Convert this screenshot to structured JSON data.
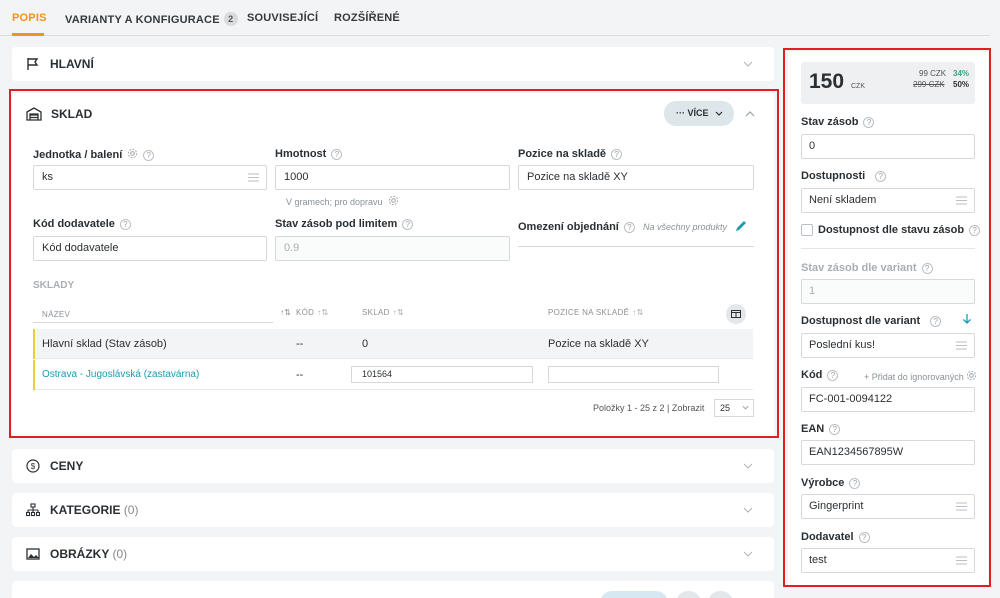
{
  "tabs": [
    {
      "label": "POPIS"
    },
    {
      "label": "VARIANTY A KONFIGURACE",
      "badge": "2"
    },
    {
      "label": "SOUVISEJÍCÍ"
    },
    {
      "label": "ROZŠÍŘENÉ"
    }
  ],
  "sections": {
    "hlavni": {
      "title": "HLAVNÍ"
    },
    "sklad": {
      "title": "SKLAD",
      "more_label": "··· VÍCE"
    },
    "ceny": {
      "title": "CENY"
    },
    "kategorie": {
      "title": "KATEGORIE",
      "count": "(0)"
    },
    "obrazky": {
      "title": "OBRÁZKY",
      "count": "(0)"
    }
  },
  "sklad_form": {
    "unit_label": "Jednotka / balení",
    "unit_value": "ks",
    "weight_label": "Hmotnost",
    "weight_value": "1000",
    "weight_hint": "V gramech; pro dopravu",
    "position_label": "Pozice na skladě",
    "position_value": "Pozice na skladě XY",
    "supplier_code_label": "Kód dodavatele",
    "supplier_code_placeholder": "Kód dodavatele",
    "low_stock_label": "Stav zásob pod limitem",
    "low_stock_placeholder": "0.9",
    "order_limit_label": "Omezení objednání",
    "order_limit_value": "Na všechny produkty"
  },
  "warehouses": {
    "title": "SKLADY",
    "headers": {
      "name": "NÁZEV",
      "code": "KÓD",
      "stock": "SKLAD",
      "position": "POZICE NA SKLADĚ"
    },
    "rows": [
      {
        "name": "Hlavní sklad (Stav zásob)",
        "code": "--",
        "stock": "0",
        "position": "Pozice na skladě XY"
      },
      {
        "name": "Ostrava - Jugoslávská (zastavárna)",
        "code": "--",
        "stock": "101564",
        "position": ""
      }
    ],
    "pagination": "Položky 1 - 25 z 2 | Zobrazit",
    "page_size": "25"
  },
  "price": {
    "value": "150",
    "currency": "CZK",
    "line1_price": "99 CZK",
    "line1_pct": "34%",
    "line2_price": "299 CZK",
    "line2_pct": "50%"
  },
  "right_panel": {
    "stock_label": "Stav zásob",
    "stock_value": "0",
    "availability_label": "Dostupnosti",
    "availability_value": "Není skladem",
    "by_stock_label": "Dostupnost dle stavu zásob",
    "variant_stock_label": "Stav zásob dle variant",
    "variant_stock_placeholder": "1",
    "variant_avail_label": "Dostupnost dle variant",
    "variant_avail_value": "Poslední kus!",
    "code_label": "Kód",
    "code_add": "+ Přidat do ignorovaných",
    "code_value": "FC-001-0094122",
    "ean_label": "EAN",
    "ean_value": "EAN1234567895W",
    "maker_label": "Výrobce",
    "maker_value": "Gingerprint",
    "supplier_label": "Dodavatel",
    "supplier_value": "test"
  },
  "colors": {
    "accent": "#f0921c",
    "link": "#1a9bb0",
    "highlight": "#e02020",
    "green": "#2eaa7c"
  }
}
